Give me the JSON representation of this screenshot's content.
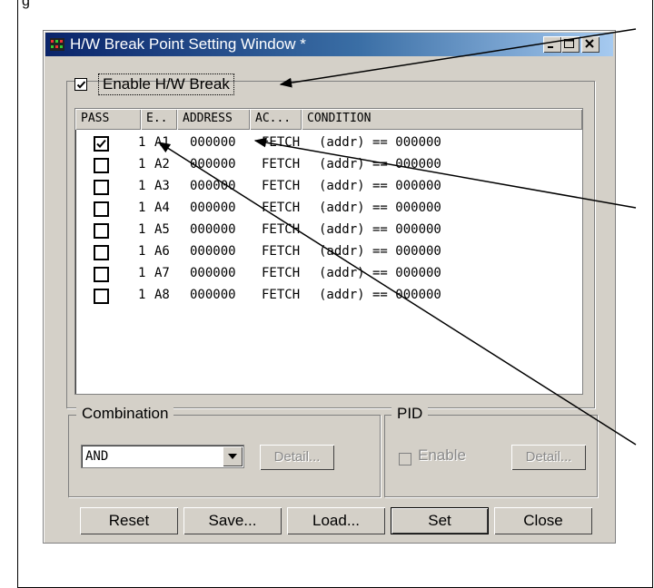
{
  "caption_fragment": "g",
  "window": {
    "title": "H/W Break Point Setting Window *",
    "controls": [
      "minimize",
      "maximize",
      "close"
    ]
  },
  "enable_hw_break": {
    "label": "Enable H/W Break",
    "checked": true
  },
  "list": {
    "columns": [
      "PASS",
      "E..",
      "ADDRESS",
      "AC...",
      "CONDITION"
    ],
    "rows": [
      {
        "checked": true,
        "pass": "1",
        "event": "A1",
        "address": "000000",
        "access": "FETCH",
        "condition": "(addr) == 000000"
      },
      {
        "checked": false,
        "pass": "1",
        "event": "A2",
        "address": "000000",
        "access": "FETCH",
        "condition": "(addr) == 000000"
      },
      {
        "checked": false,
        "pass": "1",
        "event": "A3",
        "address": "000000",
        "access": "FETCH",
        "condition": "(addr) == 000000"
      },
      {
        "checked": false,
        "pass": "1",
        "event": "A4",
        "address": "000000",
        "access": "FETCH",
        "condition": "(addr) == 000000"
      },
      {
        "checked": false,
        "pass": "1",
        "event": "A5",
        "address": "000000",
        "access": "FETCH",
        "condition": "(addr) == 000000"
      },
      {
        "checked": false,
        "pass": "1",
        "event": "A6",
        "address": "000000",
        "access": "FETCH",
        "condition": "(addr) == 000000"
      },
      {
        "checked": false,
        "pass": "1",
        "event": "A7",
        "address": "000000",
        "access": "FETCH",
        "condition": "(addr) == 000000"
      },
      {
        "checked": false,
        "pass": "1",
        "event": "A8",
        "address": "000000",
        "access": "FETCH",
        "condition": "(addr) == 000000"
      }
    ]
  },
  "combination": {
    "label": "Combination",
    "value": "AND",
    "detail_label": "Detail..."
  },
  "pid": {
    "label": "PID",
    "enable_label": "Enable",
    "detail_label": "Detail..."
  },
  "buttons": {
    "reset": "Reset",
    "save": "Save...",
    "load": "Load...",
    "set": "Set",
    "close": "Close"
  },
  "colors": {
    "title_start": "#0a246a",
    "title_end": "#a6caf0",
    "face": "#d4d0c8"
  }
}
